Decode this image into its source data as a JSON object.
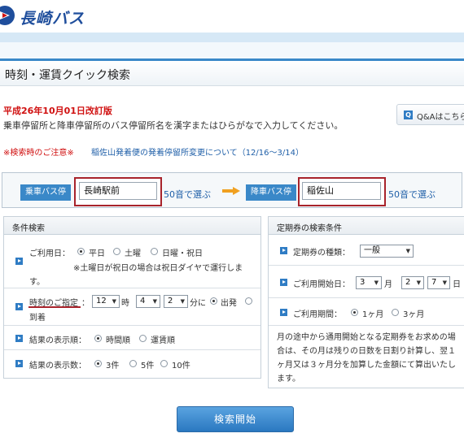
{
  "header": {
    "logo_text": "長崎バス"
  },
  "page_title": "時刻・運賃クイック検索",
  "revision": "平成26年10月01日改訂版",
  "instruction": "乗車停留所と降車停留所のバス停留所名を漢字またはひらがなで入力してください。",
  "qa_button": "Q&Aはこちら",
  "notice": {
    "label": "※検索時のご注意※",
    "link": "稲佐山発着便の発着停留所変更について（12/16～3/14）"
  },
  "stops": {
    "from_label": "乗車バス停",
    "from_value": "長崎駅前",
    "to_label": "降車バス停",
    "to_value": "稲佐山",
    "pick_50": "50音で選ぶ"
  },
  "conditions": {
    "title": "条件検索",
    "date": {
      "label": "ご利用日：",
      "opt1": "平日",
      "opt2": "土曜",
      "opt3": "日曜・祝日",
      "note": "※土曜日が祝日の場合は祝日ダイヤで運行しま",
      "note2": "す。"
    },
    "time": {
      "label": "時刻のご指定",
      "colon": "：",
      "hour": "12",
      "hour_unit": "時",
      "min1": "4",
      "min2": "2",
      "min_unit": "分に",
      "dep": "出発",
      "arr": "到着"
    },
    "order": {
      "label": "結果の表示順：",
      "opt1": "時間順",
      "opt2": "運賃順"
    },
    "count": {
      "label": "結果の表示数：",
      "opt1": "3件",
      "opt2": "5件",
      "opt3": "10件"
    }
  },
  "commuter": {
    "title": "定期券の検索条件",
    "kind": {
      "label": "定期券の種類：",
      "value": "一般"
    },
    "start": {
      "label": "ご利用開始日：",
      "month": "3",
      "month_unit": "月",
      "day1": "2",
      "day2": "7",
      "day_unit": "日"
    },
    "period": {
      "label": "ご利用期間：",
      "opt1": "1ヶ月",
      "opt2": "3ヶ月"
    },
    "note": "月の途中から通用開始となる定期券をお求めの場合は、その月は残りの日数を日割り計算し、翌１ヶ月又は３ヶ月分を加算した金額にて算出いたします。"
  },
  "search_button": "検索開始",
  "colors": {
    "brand": "#1f4e9c",
    "accent": "#3a88c8",
    "alert": "#d01010",
    "frame": "#a8232b"
  }
}
